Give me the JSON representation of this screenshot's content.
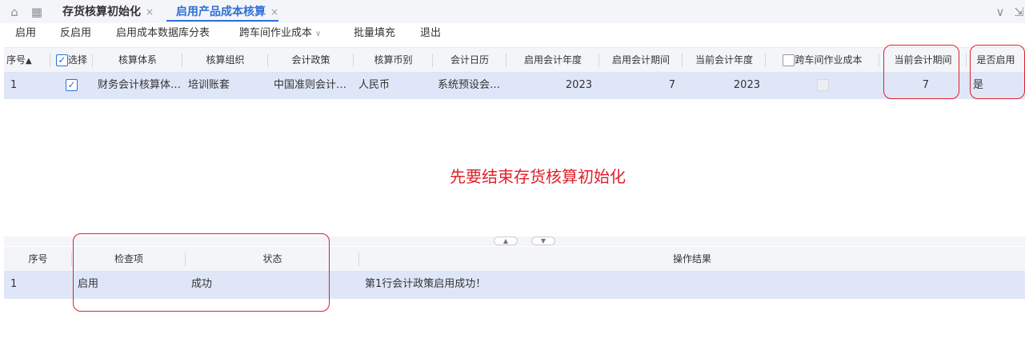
{
  "tabs": [
    {
      "label": "存货核算初始化"
    },
    {
      "label": "启用产品成本核算"
    }
  ],
  "toolbar": {
    "enable": "启用",
    "disable": "反启用",
    "db_category": "启用成本数据库分表",
    "cross_workshop": "跨车间作业成本",
    "batch_fill": "批量填充",
    "exit": "退出"
  },
  "upper_grid": {
    "columns": [
      "序号",
      "选择",
      "核算体系",
      "核算组织",
      "会计政策",
      "核算币别",
      "会计日历",
      "启用会计年度",
      "启用会计期间",
      "当前会计年度",
      "跨车间作业成本",
      "当前会计期间",
      "是否启用"
    ],
    "sort_indicator": "▲",
    "rows": [
      {
        "seq": "1",
        "selected": true,
        "system": "财务会计核算体…",
        "org": "培训账套",
        "policy": "中国准则会计…",
        "currency": "人民币",
        "calendar": "系统预设会…",
        "start_year": "2023",
        "start_period": "7",
        "current_year": "2023",
        "cross_workshop": false,
        "current_period": "7",
        "enabled": "是"
      }
    ]
  },
  "annotation": "先要结束存货核算初始化",
  "lower_grid": {
    "columns": [
      "序号",
      "检查项",
      "状态",
      "操作结果"
    ],
    "rows": [
      {
        "seq": "1",
        "item": "启用",
        "status": "成功",
        "result": "第1行会计政策启用成功！"
      }
    ]
  },
  "colors": {
    "accent": "#2e6fd8",
    "selected_row": "#dfe6f8",
    "annotation_red": "#e0202a"
  }
}
